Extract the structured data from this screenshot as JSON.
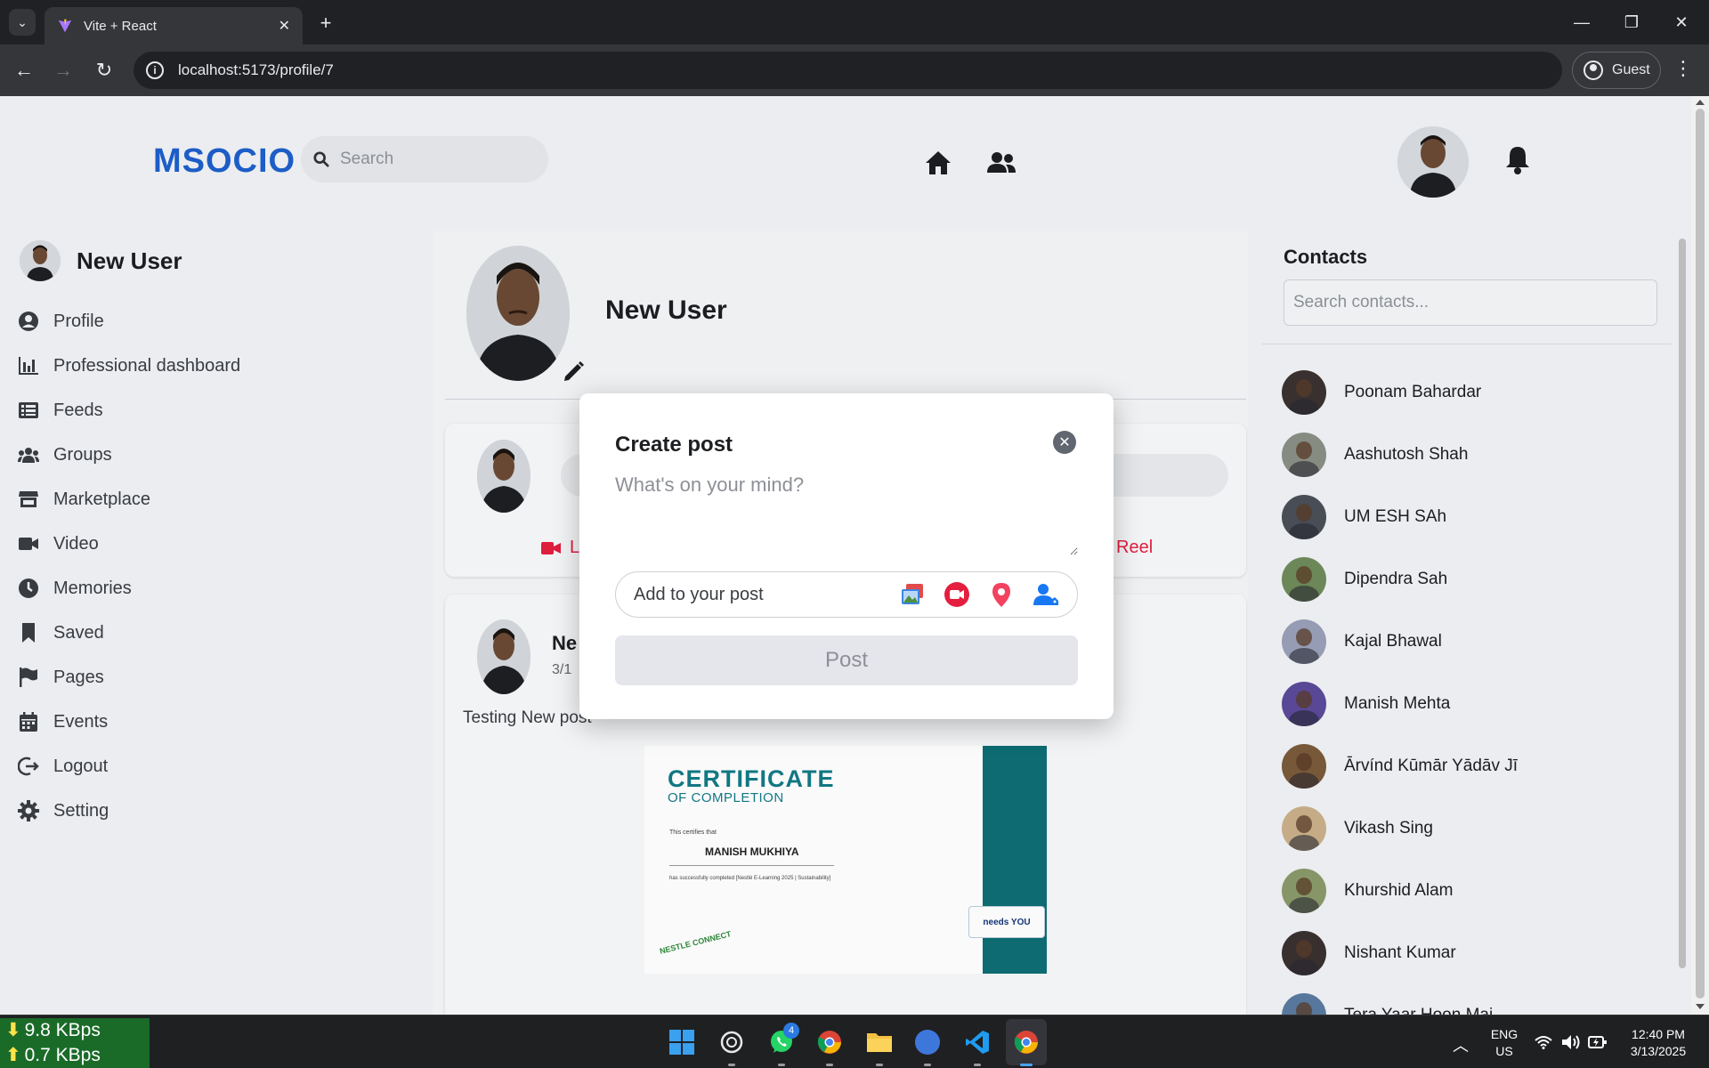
{
  "browser": {
    "tab_title": "Vite + React",
    "url": "localhost:5173/profile/7",
    "profile_label": "Guest"
  },
  "header": {
    "brand": "MSOCIO",
    "search_placeholder": "Search"
  },
  "sidebar": {
    "user_name": "New User",
    "items": [
      {
        "label": "Profile",
        "icon": "user-circle-icon"
      },
      {
        "label": "Professional dashboard",
        "icon": "bar-chart-icon"
      },
      {
        "label": "Feeds",
        "icon": "list-icon"
      },
      {
        "label": "Groups",
        "icon": "users-icon"
      },
      {
        "label": "Marketplace",
        "icon": "store-icon"
      },
      {
        "label": "Video",
        "icon": "video-icon"
      },
      {
        "label": "Memories",
        "icon": "clock-icon"
      },
      {
        "label": "Saved",
        "icon": "bookmark-icon"
      },
      {
        "label": "Pages",
        "icon": "flag-icon"
      },
      {
        "label": "Events",
        "icon": "calendar-icon"
      },
      {
        "label": "Logout",
        "icon": "logout-icon"
      },
      {
        "label": "Setting",
        "icon": "gear-icon"
      }
    ]
  },
  "profile": {
    "name": "New User"
  },
  "composer": {
    "live_label": "Li",
    "reel_label": "Reel"
  },
  "post": {
    "author": "Ne",
    "date": "3/1",
    "text": "Testing New post",
    "certificate": {
      "title": "CERTIFICATE",
      "subtitle": "OF COMPLETION",
      "certifies": "This certifies that",
      "name": "MANISH MUKHIYA",
      "desc": "has successfully completed [Nestlé E-Learning 2025 | Sustainability]",
      "badge": "needs YOU",
      "logo": "NESTLE CONNECT"
    }
  },
  "contacts": {
    "title": "Contacts",
    "search_placeholder": "Search contacts...",
    "list": [
      {
        "name": "Poonam Bahardar",
        "color": "#3b3230"
      },
      {
        "name": "Aashutosh Shah",
        "color": "#8a8f86"
      },
      {
        "name": "UM ESH SAh",
        "color": "#4a4f58"
      },
      {
        "name": "Dipendra Sah",
        "color": "#6f8a5a"
      },
      {
        "name": "Kajal Bhawal",
        "color": "#9aa0b8"
      },
      {
        "name": "Manish Mehta",
        "color": "#5b4a9a"
      },
      {
        "name": "Ārvínd Kūmār Yādāv Jī",
        "color": "#7a5a3a"
      },
      {
        "name": "Vikash Sing",
        "color": "#c9b08a"
      },
      {
        "name": "Khurshid Alam",
        "color": "#8a9a6a"
      },
      {
        "name": "Nishant Kumar",
        "color": "#3a3030"
      },
      {
        "name": "Tera Yaar Hoon Mai",
        "color": "#5a7aa0"
      }
    ]
  },
  "modal": {
    "title": "Create post",
    "placeholder": "What's on your mind?",
    "add_label": "Add to your post",
    "post_button": "Post"
  },
  "taskbar": {
    "download_speed": "9.8 KBps",
    "upload_speed": "0.7 KBps",
    "whatsapp_badge": "4",
    "lang_1": "ENG",
    "lang_2": "US",
    "time": "12:40 PM",
    "date": "3/13/2025"
  },
  "colors": {
    "brand": "#1d5fcb",
    "live_red": "#e41e3f",
    "page_bg": "#f0f2f5"
  }
}
